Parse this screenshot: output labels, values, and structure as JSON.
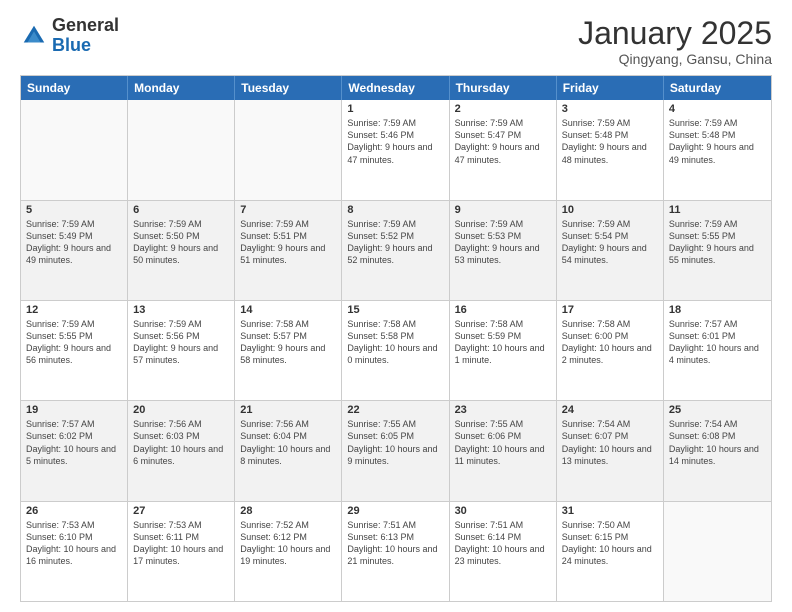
{
  "logo": {
    "general": "General",
    "blue": "Blue"
  },
  "title": "January 2025",
  "subtitle": "Qingyang, Gansu, China",
  "days": [
    "Sunday",
    "Monday",
    "Tuesday",
    "Wednesday",
    "Thursday",
    "Friday",
    "Saturday"
  ],
  "weeks": [
    [
      {
        "day": "",
        "info": "",
        "empty": true
      },
      {
        "day": "",
        "info": "",
        "empty": true
      },
      {
        "day": "",
        "info": "",
        "empty": true
      },
      {
        "day": "1",
        "info": "Sunrise: 7:59 AM\nSunset: 5:46 PM\nDaylight: 9 hours\nand 47 minutes."
      },
      {
        "day": "2",
        "info": "Sunrise: 7:59 AM\nSunset: 5:47 PM\nDaylight: 9 hours\nand 47 minutes."
      },
      {
        "day": "3",
        "info": "Sunrise: 7:59 AM\nSunset: 5:48 PM\nDaylight: 9 hours\nand 48 minutes."
      },
      {
        "day": "4",
        "info": "Sunrise: 7:59 AM\nSunset: 5:48 PM\nDaylight: 9 hours\nand 49 minutes."
      }
    ],
    [
      {
        "day": "5",
        "info": "Sunrise: 7:59 AM\nSunset: 5:49 PM\nDaylight: 9 hours\nand 49 minutes.",
        "shaded": true
      },
      {
        "day": "6",
        "info": "Sunrise: 7:59 AM\nSunset: 5:50 PM\nDaylight: 9 hours\nand 50 minutes.",
        "shaded": true
      },
      {
        "day": "7",
        "info": "Sunrise: 7:59 AM\nSunset: 5:51 PM\nDaylight: 9 hours\nand 51 minutes.",
        "shaded": true
      },
      {
        "day": "8",
        "info": "Sunrise: 7:59 AM\nSunset: 5:52 PM\nDaylight: 9 hours\nand 52 minutes.",
        "shaded": true
      },
      {
        "day": "9",
        "info": "Sunrise: 7:59 AM\nSunset: 5:53 PM\nDaylight: 9 hours\nand 53 minutes.",
        "shaded": true
      },
      {
        "day": "10",
        "info": "Sunrise: 7:59 AM\nSunset: 5:54 PM\nDaylight: 9 hours\nand 54 minutes.",
        "shaded": true
      },
      {
        "day": "11",
        "info": "Sunrise: 7:59 AM\nSunset: 5:55 PM\nDaylight: 9 hours\nand 55 minutes.",
        "shaded": true
      }
    ],
    [
      {
        "day": "12",
        "info": "Sunrise: 7:59 AM\nSunset: 5:55 PM\nDaylight: 9 hours\nand 56 minutes."
      },
      {
        "day": "13",
        "info": "Sunrise: 7:59 AM\nSunset: 5:56 PM\nDaylight: 9 hours\nand 57 minutes."
      },
      {
        "day": "14",
        "info": "Sunrise: 7:58 AM\nSunset: 5:57 PM\nDaylight: 9 hours\nand 58 minutes."
      },
      {
        "day": "15",
        "info": "Sunrise: 7:58 AM\nSunset: 5:58 PM\nDaylight: 10 hours\nand 0 minutes."
      },
      {
        "day": "16",
        "info": "Sunrise: 7:58 AM\nSunset: 5:59 PM\nDaylight: 10 hours\nand 1 minute."
      },
      {
        "day": "17",
        "info": "Sunrise: 7:58 AM\nSunset: 6:00 PM\nDaylight: 10 hours\nand 2 minutes."
      },
      {
        "day": "18",
        "info": "Sunrise: 7:57 AM\nSunset: 6:01 PM\nDaylight: 10 hours\nand 4 minutes."
      }
    ],
    [
      {
        "day": "19",
        "info": "Sunrise: 7:57 AM\nSunset: 6:02 PM\nDaylight: 10 hours\nand 5 minutes.",
        "shaded": true
      },
      {
        "day": "20",
        "info": "Sunrise: 7:56 AM\nSunset: 6:03 PM\nDaylight: 10 hours\nand 6 minutes.",
        "shaded": true
      },
      {
        "day": "21",
        "info": "Sunrise: 7:56 AM\nSunset: 6:04 PM\nDaylight: 10 hours\nand 8 minutes.",
        "shaded": true
      },
      {
        "day": "22",
        "info": "Sunrise: 7:55 AM\nSunset: 6:05 PM\nDaylight: 10 hours\nand 9 minutes.",
        "shaded": true
      },
      {
        "day": "23",
        "info": "Sunrise: 7:55 AM\nSunset: 6:06 PM\nDaylight: 10 hours\nand 11 minutes.",
        "shaded": true
      },
      {
        "day": "24",
        "info": "Sunrise: 7:54 AM\nSunset: 6:07 PM\nDaylight: 10 hours\nand 13 minutes.",
        "shaded": true
      },
      {
        "day": "25",
        "info": "Sunrise: 7:54 AM\nSunset: 6:08 PM\nDaylight: 10 hours\nand 14 minutes.",
        "shaded": true
      }
    ],
    [
      {
        "day": "26",
        "info": "Sunrise: 7:53 AM\nSunset: 6:10 PM\nDaylight: 10 hours\nand 16 minutes."
      },
      {
        "day": "27",
        "info": "Sunrise: 7:53 AM\nSunset: 6:11 PM\nDaylight: 10 hours\nand 17 minutes."
      },
      {
        "day": "28",
        "info": "Sunrise: 7:52 AM\nSunset: 6:12 PM\nDaylight: 10 hours\nand 19 minutes."
      },
      {
        "day": "29",
        "info": "Sunrise: 7:51 AM\nSunset: 6:13 PM\nDaylight: 10 hours\nand 21 minutes."
      },
      {
        "day": "30",
        "info": "Sunrise: 7:51 AM\nSunset: 6:14 PM\nDaylight: 10 hours\nand 23 minutes."
      },
      {
        "day": "31",
        "info": "Sunrise: 7:50 AM\nSunset: 6:15 PM\nDaylight: 10 hours\nand 24 minutes."
      },
      {
        "day": "",
        "info": "",
        "empty": true
      }
    ]
  ]
}
